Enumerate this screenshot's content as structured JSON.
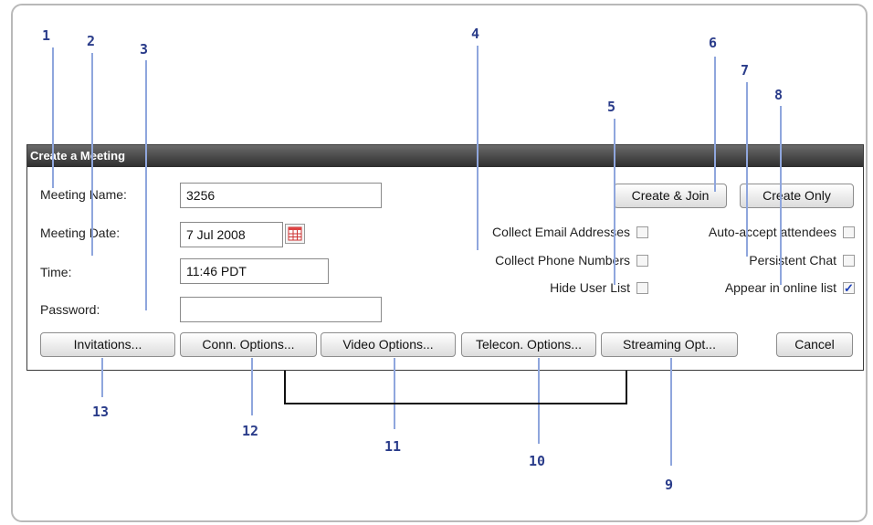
{
  "dialog": {
    "title": "Create a Meeting",
    "meeting_name_label": "Meeting Name:",
    "meeting_name_value": "3256",
    "meeting_date_label": "Meeting Date:",
    "meeting_date_value": "7 Jul 2008",
    "time_label": "Time:",
    "time_value": "11:46 PDT",
    "password_label": "Password:",
    "password_value": "",
    "create_join_label": "Create & Join",
    "create_only_label": "Create Only",
    "cancel_label": "Cancel",
    "checkboxes": [
      {
        "label": "Collect Email Addresses",
        "checked": false
      },
      {
        "label": "Collect Phone Numbers",
        "checked": false
      },
      {
        "label": "Hide User List",
        "checked": false
      },
      {
        "label": "Auto-accept attendees",
        "checked": false
      },
      {
        "label": "Persistent Chat",
        "checked": false
      },
      {
        "label": "Appear in online list",
        "checked": true
      }
    ],
    "bottom_buttons": [
      "Invitations...",
      "Conn. Options...",
      "Video Options...",
      "Telecon. Options...",
      "Streaming Opt..."
    ]
  },
  "callouts": [
    "1",
    "2",
    "3",
    "4",
    "5",
    "6",
    "7",
    "8",
    "9",
    "10",
    "11",
    "12",
    "13"
  ],
  "colors": {
    "callout": "#2a3c8a",
    "callout_line": "#8fa6dd",
    "titlebar": "#3a3a3a"
  }
}
